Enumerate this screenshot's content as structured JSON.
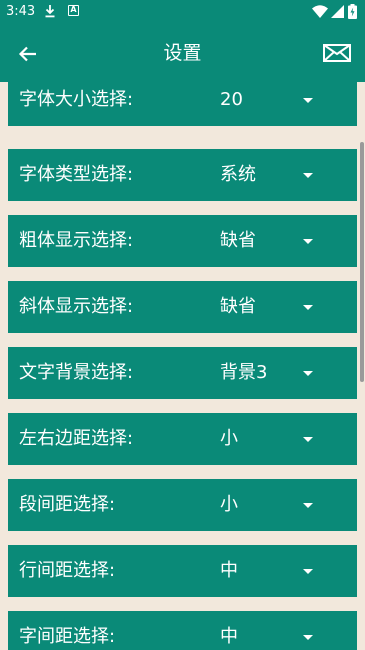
{
  "status_bar": {
    "time": "3:43",
    "download_icon": "download-icon",
    "notification_icon": "A",
    "wifi_icon": "wifi-icon",
    "signal_icon": "signal-icon",
    "battery_icon": "battery-charging-icon"
  },
  "app_bar": {
    "title": "设置",
    "back_icon": "arrow-back-icon",
    "mail_icon": "mail-icon",
    "color": "#0a8a78"
  },
  "background_color": "#f2e8dc",
  "settings": [
    {
      "label": "字体大小选择:",
      "value": "20"
    },
    {
      "label": "字体类型选择:",
      "value": "系统"
    },
    {
      "label": "粗体显示选择:",
      "value": "缺省"
    },
    {
      "label": "斜体显示选择:",
      "value": "缺省"
    },
    {
      "label": "文字背景选择:",
      "value": "背景3"
    },
    {
      "label": "左右边距选择:",
      "value": "小"
    },
    {
      "label": "段间距选择:",
      "value": "小"
    },
    {
      "label": "行间距选择:",
      "value": "中"
    },
    {
      "label": "字间距选择:",
      "value": "中"
    }
  ]
}
